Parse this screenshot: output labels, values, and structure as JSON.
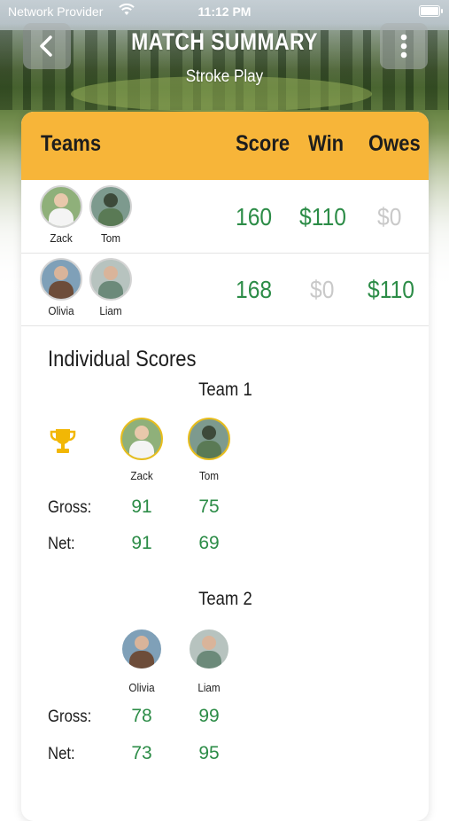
{
  "status_bar": {
    "carrier": "Network Provider",
    "time": "11:12 PM"
  },
  "header": {
    "title": "MATCH SUMMARY",
    "subtitle": "Stroke Play",
    "back_icon": "chevron-left-icon",
    "more_icon": "vertical-ellipsis-icon"
  },
  "table": {
    "columns": {
      "teams": "Teams",
      "score": "Score",
      "win": "Win",
      "owes": "Owes"
    },
    "rows": [
      {
        "players": [
          "Zack",
          "Tom"
        ],
        "score": "160",
        "win": "$110",
        "owes": "$0"
      },
      {
        "players": [
          "Olivia",
          "Liam"
        ],
        "score": "168",
        "win": "$0",
        "owes": "$110"
      }
    ]
  },
  "individual": {
    "title": "Individual Scores",
    "gross_label": "Gross:",
    "net_label": "Net:",
    "teams": [
      {
        "name": "Team 1",
        "winner_icon": "trophy-icon",
        "players": [
          {
            "name": "Zack",
            "gross": "91",
            "net": "91"
          },
          {
            "name": "Tom",
            "gross": "75",
            "net": "69"
          }
        ]
      },
      {
        "name": "Team 2",
        "players": [
          {
            "name": "Olivia",
            "gross": "78",
            "net": "73"
          },
          {
            "name": "Liam",
            "gross": "99",
            "net": "95"
          }
        ]
      }
    ]
  },
  "colors": {
    "accent": "#f7b539",
    "positive": "#2c8c47",
    "muted": "#c9c9c9",
    "winner_ring": "#e7bd1e"
  }
}
